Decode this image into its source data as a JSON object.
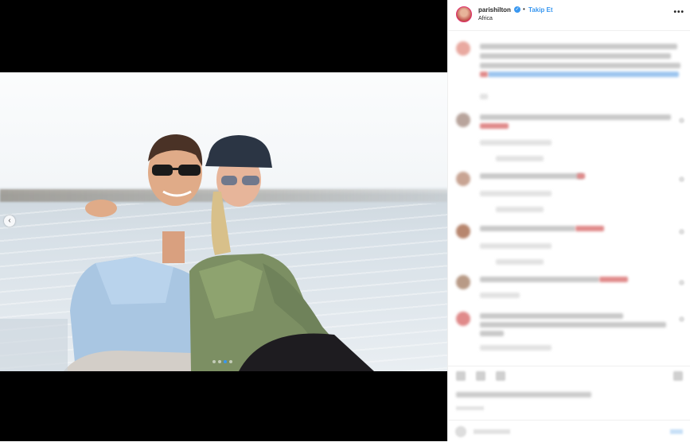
{
  "post": {
    "username": "parishilton",
    "verified_icon": "verified-badge-icon",
    "follow_label": "Takip Et",
    "separator": "•",
    "location": "Africa",
    "more_label": "•••"
  },
  "media": {
    "prev_arrow": "‹",
    "carousel_count": 4,
    "carousel_active": 3
  },
  "colors": {
    "accent": "#3897f0",
    "text": "#262626",
    "border": "#efefef"
  }
}
